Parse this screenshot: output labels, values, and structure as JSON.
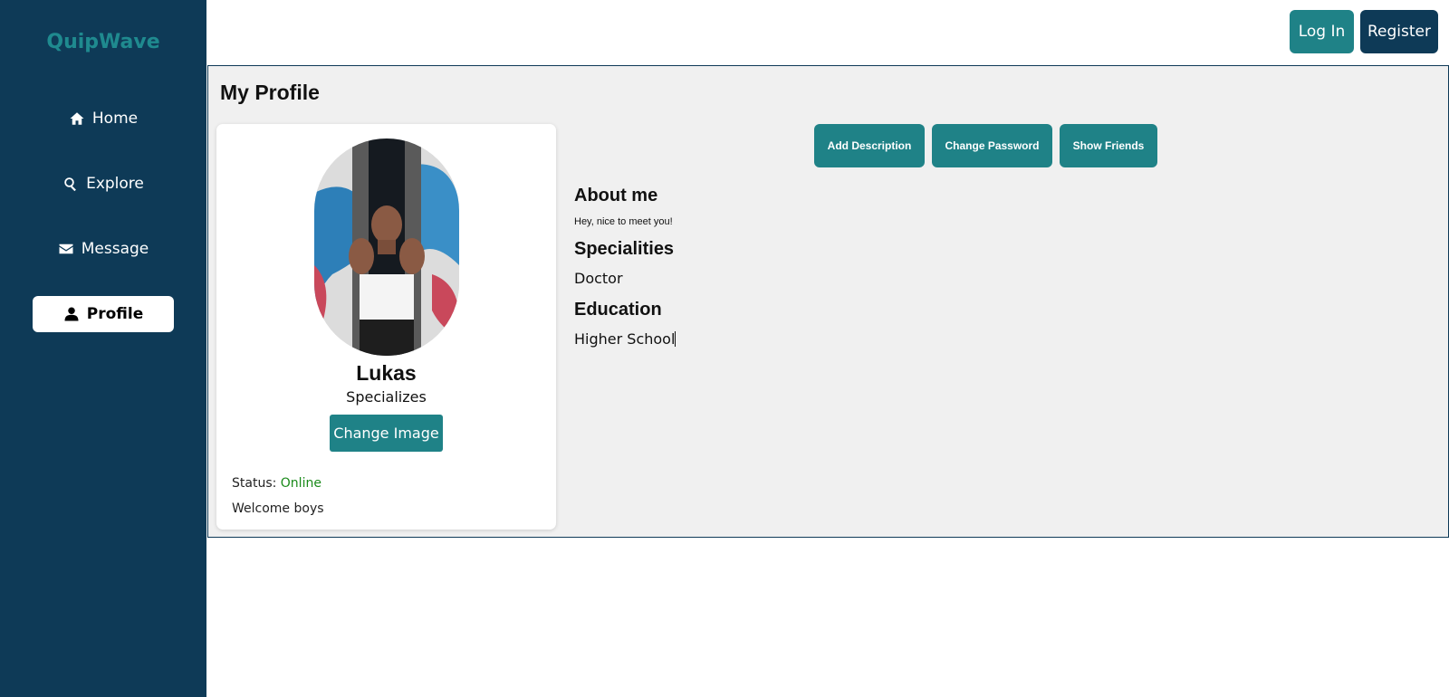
{
  "sidebar": {
    "brand": "QuipWave",
    "items": [
      {
        "label": "Home",
        "icon": "home-icon"
      },
      {
        "label": "Explore",
        "icon": "search-icon"
      },
      {
        "label": "Message",
        "icon": "envelope-icon"
      },
      {
        "label": "Profile",
        "icon": "user-icon",
        "active": true
      }
    ]
  },
  "header": {
    "login_label": "Log In",
    "register_label": "Register"
  },
  "profile": {
    "page_title": "My Profile",
    "name": "Lukas",
    "specializes": "Specializes",
    "change_image_label": "Change Image",
    "status_label": "Status:",
    "status_value": "Online",
    "welcome_text": "Welcome boys"
  },
  "actions": {
    "add_description": "Add Description",
    "change_password": "Change Password",
    "show_friends": "Show Friends"
  },
  "details": {
    "about_heading": "About me",
    "about_text": "Hey, nice to meet you!",
    "specialities_heading": "Specialities",
    "specialities_text": "Doctor",
    "education_heading": "Education",
    "education_text": "Higher School"
  },
  "colors": {
    "sidebar_bg": "#0e3a57",
    "accent": "#1f8287",
    "brand": "#1f8a8f",
    "status_online": "#1a8a1a"
  }
}
